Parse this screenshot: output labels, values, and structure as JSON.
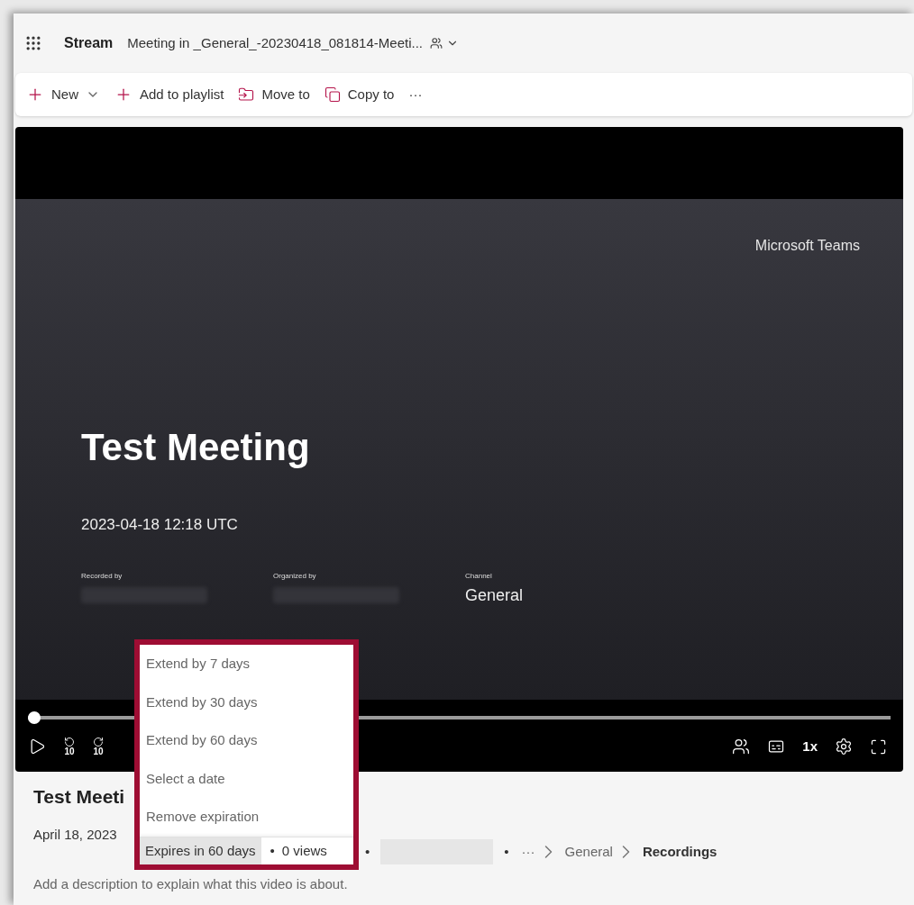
{
  "header": {
    "app_name": "Stream",
    "file_title": "Meeting in _General_-20230418_081814-Meeti..."
  },
  "toolbar": [
    {
      "kind": "new",
      "label": "New"
    },
    {
      "kind": "add",
      "label": "Add to playlist"
    },
    {
      "kind": "move",
      "label": "Move to"
    },
    {
      "kind": "copy",
      "label": "Copy to"
    },
    {
      "kind": "more",
      "label": "···"
    }
  ],
  "player": {
    "brand": "Microsoft Teams",
    "title": "Test Meeting",
    "datetime": "2023-04-18 12:18 UTC",
    "fields": [
      {
        "label": "Recorded by",
        "redacted": true
      },
      {
        "label": "Organized by",
        "redacted": true
      },
      {
        "label": "Channel",
        "value": "General",
        "redacted": false
      }
    ],
    "progress": {
      "level": 0
    },
    "skip_back": "10",
    "skip_forward": "10",
    "speed": "1x"
  },
  "video_title": "Test Meeti",
  "meta": {
    "date": "April 18, 2023",
    "expires": "Expires in 60 days",
    "views": "0 views",
    "separators": [
      "•",
      "•",
      "•"
    ],
    "breadcrumb": [
      {
        "label": "···",
        "current": false
      },
      {
        "label": "General",
        "current": false
      },
      {
        "label": "Recordings",
        "current": true
      }
    ]
  },
  "expiration_menu": [
    {
      "label": "Extend by 7 days"
    },
    {
      "label": "Extend by 30 days"
    },
    {
      "label": "Extend by 60 days"
    },
    {
      "label": "Select a date"
    },
    {
      "label": "Remove expiration"
    }
  ],
  "description_placeholder": "Add a description to explain what this video is about."
}
